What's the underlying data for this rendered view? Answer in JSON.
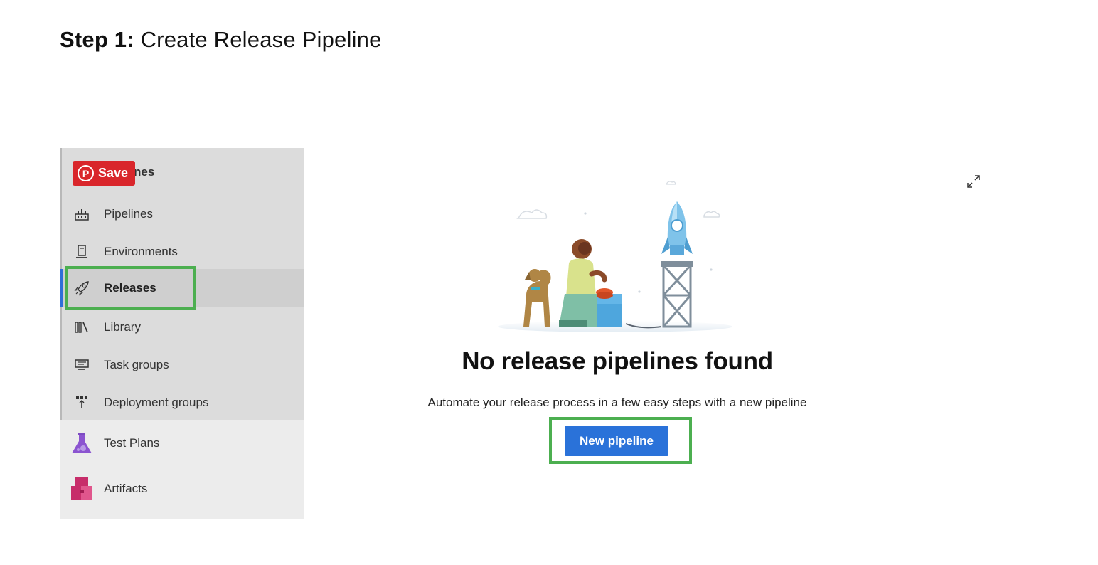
{
  "heading": {
    "strong": "Step 1:",
    "normal": "Create Release Pipeline"
  },
  "sidebar": {
    "header_label": "nes",
    "items": [
      {
        "label": "Pipelines",
        "icon": "pipelines-icon"
      },
      {
        "label": "Environments",
        "icon": "environments-icon"
      },
      {
        "label": "Releases",
        "icon": "rocket-icon",
        "active": true
      },
      {
        "label": "Library",
        "icon": "library-icon"
      },
      {
        "label": "Task groups",
        "icon": "task-groups-icon"
      },
      {
        "label": "Deployment groups",
        "icon": "deployment-groups-icon"
      },
      {
        "label": "Test Plans",
        "icon": "test-plans-icon"
      },
      {
        "label": "Artifacts",
        "icon": "artifacts-icon"
      }
    ]
  },
  "pinterest": {
    "save_label": "Save"
  },
  "main": {
    "empty_title": "No release pipelines found",
    "empty_description": "Automate your release process in a few easy steps with a new pipeline",
    "new_pipeline_label": "New pipeline"
  },
  "colors": {
    "accent": "#2a72d9",
    "highlight": "#4caf50",
    "pinterest": "#d9262b"
  }
}
